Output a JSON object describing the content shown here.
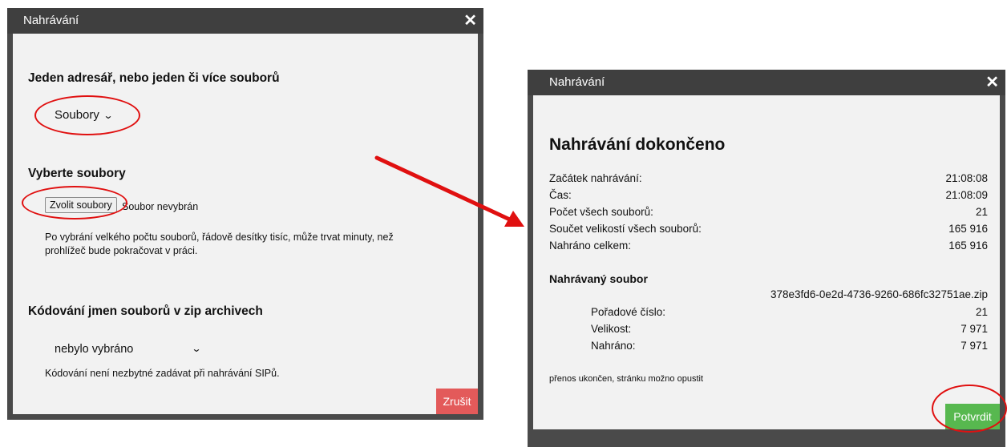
{
  "left_dialog": {
    "title": "Nahrávání",
    "section1_heading": "Jeden adresář, nebo jeden či více souborů",
    "mode_select": "Soubory",
    "section2_heading": "Vyberte soubory",
    "choose_button": "Zvolit soubory",
    "no_file_text": "Soubor nevybrán",
    "hint": "Po vybrání velkého počtu souborů, řádově desítky tisíc, může trvat minuty, než prohlížeč bude pokračovat v práci.",
    "section3_heading": "Kódování jmen souborů v zip archivech",
    "encoding_select": "nebylo vybráno",
    "encoding_note": "Kódování není nezbytné zadávat při nahrávání SIPů.",
    "cancel_button": "Zrušit"
  },
  "right_dialog": {
    "title": "Nahrávání",
    "heading": "Nahrávání dokončeno",
    "stats": [
      {
        "label": "Začátek nahrávání:",
        "value": "21:08:08"
      },
      {
        "label": "Čas:",
        "value": "21:08:09"
      },
      {
        "label": "Počet všech souborů:",
        "value": "21"
      },
      {
        "label": "Součet velikostí všech souborů:",
        "value": "165 916"
      },
      {
        "label": "Nahráno celkem:",
        "value": "165 916"
      }
    ],
    "file_heading": "Nahrávaný soubor",
    "file_name": "378e3fd6-0e2d-4736-9260-686fc32751ae.zip",
    "file_stats": [
      {
        "label": "Pořadové číslo:",
        "value": "21"
      },
      {
        "label": "Velikost:",
        "value": "7 971"
      },
      {
        "label": "Nahráno:",
        "value": "7 971"
      }
    ],
    "status_text": "přenos ukončen, stránku možno opustit",
    "confirm_button": "Potvrdit"
  },
  "colors": {
    "titlebar": "#3f3f3f",
    "cancel": "#e35a5a",
    "confirm": "#57b84f",
    "annotation": "#e01010"
  }
}
